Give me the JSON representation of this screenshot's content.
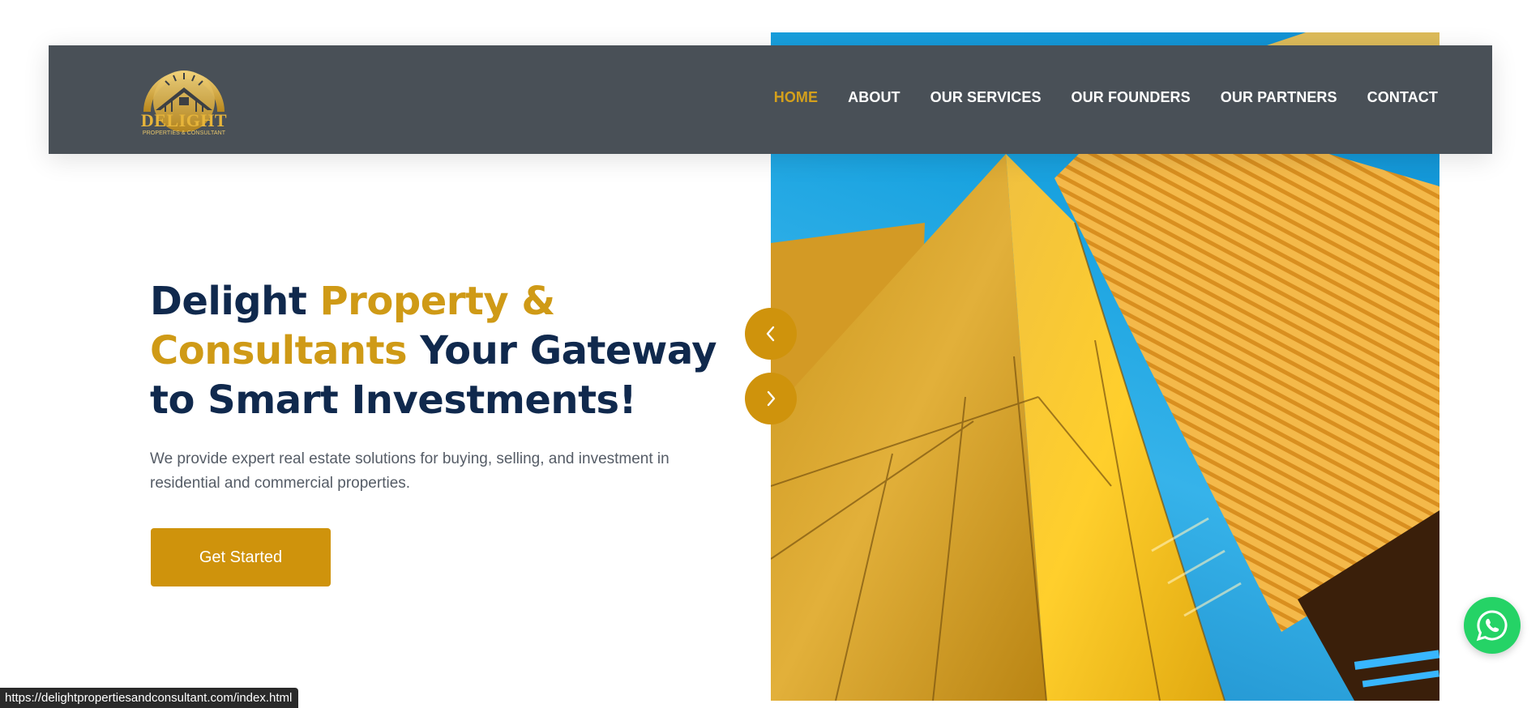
{
  "header": {
    "logo": {
      "word": "DELIGHT",
      "tagline": "PROPERTIES & CONSULTANT"
    },
    "nav": [
      {
        "label": "HOME",
        "active": true
      },
      {
        "label": "ABOUT"
      },
      {
        "label": "OUR SERVICES"
      },
      {
        "label": "OUR FOUNDERS"
      },
      {
        "label": "OUR PARTNERS"
      },
      {
        "label": "CONTACT"
      }
    ]
  },
  "hero": {
    "title_part1": "Delight ",
    "title_highlight": "Property & Consultants",
    "title_part2": " Your Gateway to Smart Investments!",
    "description": "We provide expert real estate solutions for buying, selling, and investment in residential and commercial properties.",
    "cta_label": "Get Started"
  },
  "slider": {
    "prev_icon": "chevron-left-icon",
    "next_icon": "chevron-right-icon"
  },
  "whatsapp": {
    "icon": "whatsapp-icon"
  },
  "status_bar": {
    "url": "https://delightpropertiesandconsultant.com/index.html"
  },
  "colors": {
    "header_bg": "#495057",
    "accent_gold": "#cf930c",
    "nav_active": "#d4a01c",
    "title_navy": "#10294d",
    "whatsapp_green": "#25d366"
  }
}
